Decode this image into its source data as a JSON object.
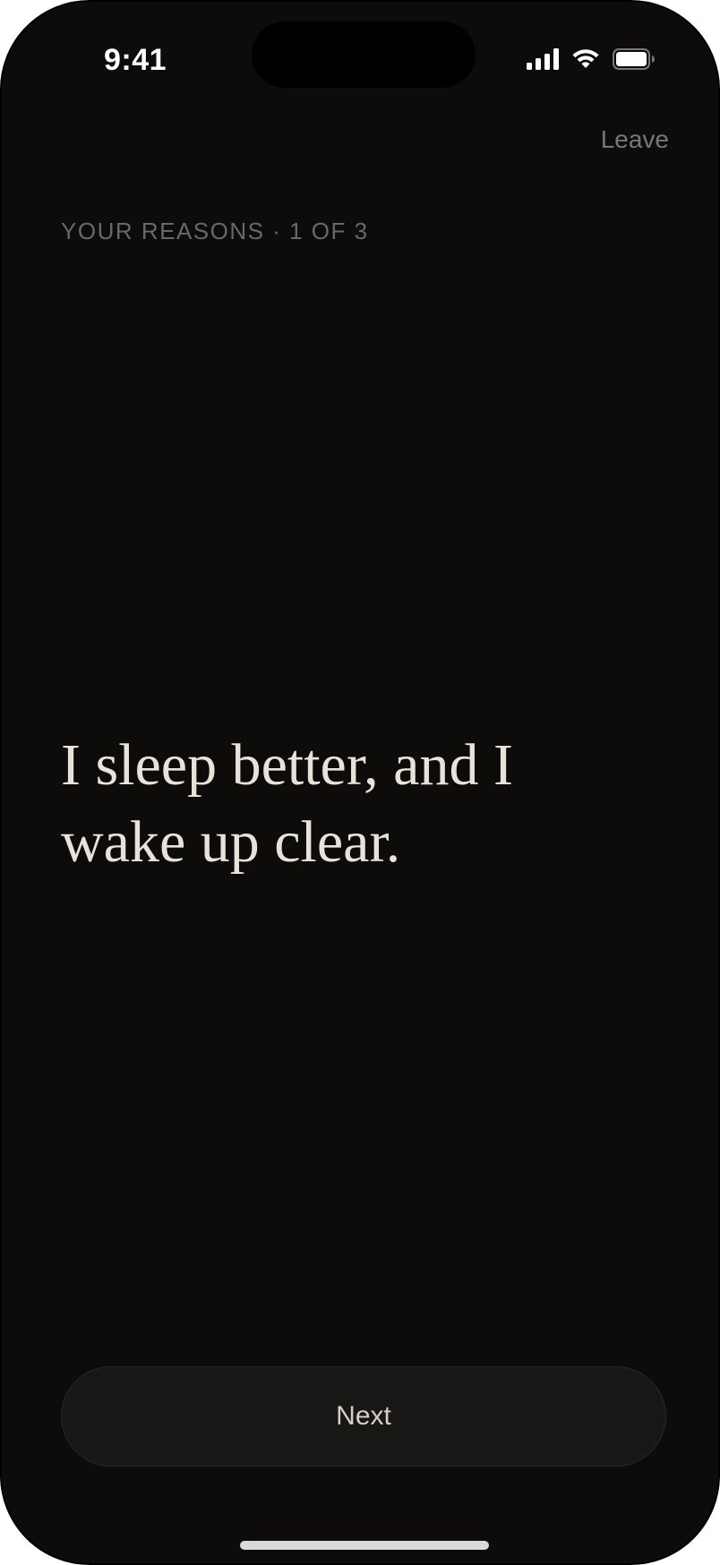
{
  "status_bar": {
    "time": "9:41",
    "icons": [
      "signal-icon",
      "wifi-icon",
      "battery-icon"
    ]
  },
  "header": {
    "leave_label": "Leave"
  },
  "progress": {
    "label": "YOUR REASONS · 1 OF 3",
    "current": 1,
    "total": 3
  },
  "reason": {
    "text": "I sleep better, and I wake up clear."
  },
  "footer": {
    "next_label": "Next"
  },
  "colors": {
    "background": "#0d0c0b",
    "reason_text": "#e8e2d8",
    "muted_text": "#6b6864",
    "button_bg": "#181715"
  }
}
